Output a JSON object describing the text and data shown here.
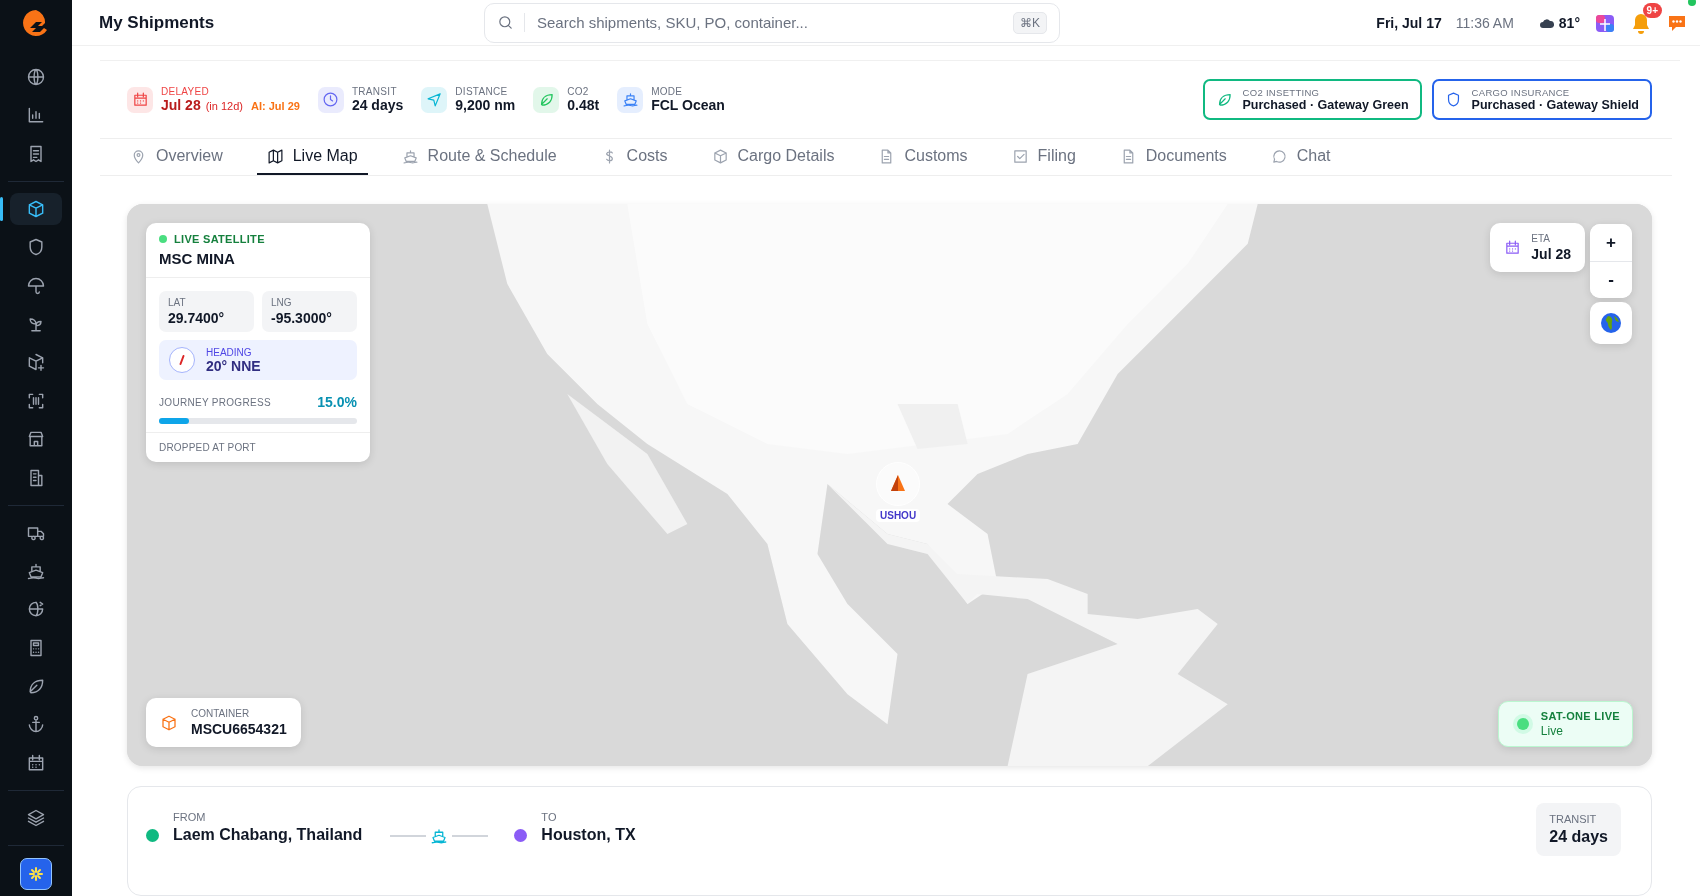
{
  "sidebar": {
    "groups": [
      [
        {
          "selected": false
        },
        {
          "selected": false
        },
        {
          "selected": false
        }
      ],
      [
        {
          "selected": true
        },
        {
          "selected": false
        },
        {
          "selected": false
        },
        {
          "selected": false
        },
        {
          "selected": false
        },
        {
          "selected": false
        },
        {
          "selected": false
        },
        {
          "selected": false
        }
      ],
      [
        {
          "selected": false
        },
        {
          "selected": false
        },
        {
          "selected": false
        },
        {
          "selected": false
        },
        {
          "selected": false
        },
        {
          "selected": false
        },
        {
          "selected": false
        }
      ],
      [
        {
          "selected": false
        }
      ]
    ]
  },
  "header": {
    "title": "My Shipments",
    "search": {
      "placeholder": "Search shipments, SKU, PO, container...",
      "shortcut": "⌘K"
    },
    "date": "Fri, Jul 17",
    "time": "11:36 AM",
    "weather": "81°",
    "notifications": "9+",
    "online": true
  },
  "metrics": [
    {
      "label": "DELAYED",
      "value": "Jul 28",
      "note": "(in 12d)",
      "ai": "AI: Jul 29",
      "color": "#ef4444"
    },
    {
      "label": "TRANSIT",
      "value": "24 days",
      "color": "#6366f1"
    },
    {
      "label": "DISTANCE",
      "value": "9,200 nm",
      "color": "#06b6d4"
    },
    {
      "label": "CO2",
      "value": "0.48t",
      "color": "#22c55e"
    },
    {
      "label": "MODE",
      "value": "FCL Ocean",
      "color": "#3b82f6"
    }
  ],
  "badges": [
    {
      "label": "CO2 INSETTING",
      "value": "Purchased · Gateway Green",
      "color": "#10b981"
    },
    {
      "label": "CARGO INSURANCE",
      "value": "Purchased · Gateway Shield",
      "color": "#2563eb"
    }
  ],
  "tabs": [
    {
      "label": "Overview",
      "selected": false
    },
    {
      "label": "Live Map",
      "selected": true
    },
    {
      "label": "Route & Schedule",
      "selected": false
    },
    {
      "label": "Costs",
      "selected": false
    },
    {
      "label": "Cargo Details",
      "selected": false
    },
    {
      "label": "Customs",
      "selected": false
    },
    {
      "label": "Filing",
      "selected": false
    },
    {
      "label": "Documents",
      "selected": false
    },
    {
      "label": "Chat",
      "selected": false
    }
  ],
  "map": {
    "kind": "picture",
    "vessel": {
      "status": "LIVE SATELLITE",
      "name": "MSC MINA",
      "lat_label": "LAT",
      "lat": "29.7400°",
      "lng_label": "LNG",
      "lng": "-95.3000°",
      "heading_label": "HEADING",
      "heading": "20° NNE",
      "progress_label": "JOURNEY PROGRESS",
      "progress_reading": "15.0%",
      "level": 0.15,
      "footer": "DROPPED AT PORT"
    },
    "eta": {
      "label": "ETA",
      "value": "Jul 28"
    },
    "zoom": [
      "+",
      "-"
    ],
    "marker": "USHOU",
    "container": {
      "label": "CONTAINER",
      "value": "MSCU6654321"
    },
    "live": {
      "label": "SAT-ONE LIVE",
      "status": "Live"
    }
  },
  "route": {
    "from_label": "FROM",
    "from": "Laem Chabang, Thailand",
    "to_label": "TO",
    "to": "Houston, TX",
    "transit_label": "TRANSIT",
    "transit": "24 days"
  }
}
